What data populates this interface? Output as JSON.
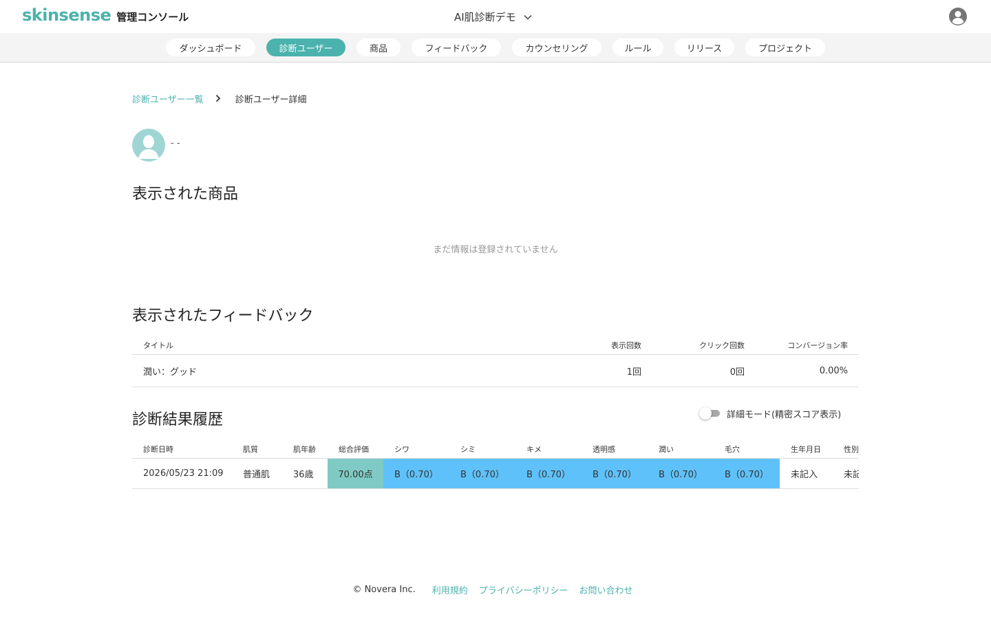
{
  "header": {
    "logo_word": "skinsense",
    "logo_sub": "管理コンソール",
    "project": "AI肌診断デモ"
  },
  "nav": {
    "tabs": [
      {
        "label": "ダッシュボード",
        "active": false
      },
      {
        "label": "診断ユーザー",
        "active": true
      },
      {
        "label": "商品",
        "active": false
      },
      {
        "label": "フィードバック",
        "active": false
      },
      {
        "label": "カウンセリング",
        "active": false
      },
      {
        "label": "ルール",
        "active": false
      },
      {
        "label": "リリース",
        "active": false
      },
      {
        "label": "プロジェクト",
        "active": false
      }
    ]
  },
  "breadcrumb": {
    "parent": "診断ユーザー一覧",
    "current": "診断ユーザー詳細"
  },
  "user": {
    "name": "- -"
  },
  "products": {
    "title": "表示された商品",
    "empty_message": "まだ情報は登録されていません"
  },
  "feedback": {
    "title": "表示されたフィードバック",
    "columns": {
      "title": "タイトル",
      "views": "表示回数",
      "clicks": "クリック回数",
      "conversion": "コンバージョン率"
    },
    "rows": [
      {
        "title": "潤い：グッド",
        "views": "1回",
        "clicks": "0回",
        "conversion": "0.00%"
      }
    ]
  },
  "history": {
    "title": "診断結果履歴",
    "toggle_label": "詳細モード(精密スコア表示)",
    "toggle_on": false,
    "columns": {
      "date": "診断日時",
      "skin_type": "肌質",
      "skin_age": "肌年齢",
      "overall": "総合評価",
      "wrinkle": "シワ",
      "spot": "シミ",
      "texture": "キメ",
      "clarity": "透明感",
      "moisture": "潤い",
      "pore": "毛穴",
      "birthdate": "生年月日",
      "gender": "性別"
    },
    "rows": [
      {
        "date": "2026/05/23 21:09",
        "skin_type": "普通肌",
        "skin_age": "36歳",
        "overall": "70.00点",
        "wrinkle": "B（0.70）",
        "spot": "B（0.70）",
        "texture": "B（0.70）",
        "clarity": "B（0.70）",
        "moisture": "B（0.70）",
        "pore": "B（0.70）",
        "birthdate": "未記入",
        "gender": "未記入"
      }
    ]
  },
  "footer": {
    "copyright": "© Novera Inc.",
    "links": [
      "利用規約",
      "プライバシーポリシー",
      "お問い合わせ"
    ]
  },
  "colors": {
    "accent": "#4bb2ad",
    "score_bg": "#7fcac4",
    "grade_bg": "#5fc1fa"
  }
}
